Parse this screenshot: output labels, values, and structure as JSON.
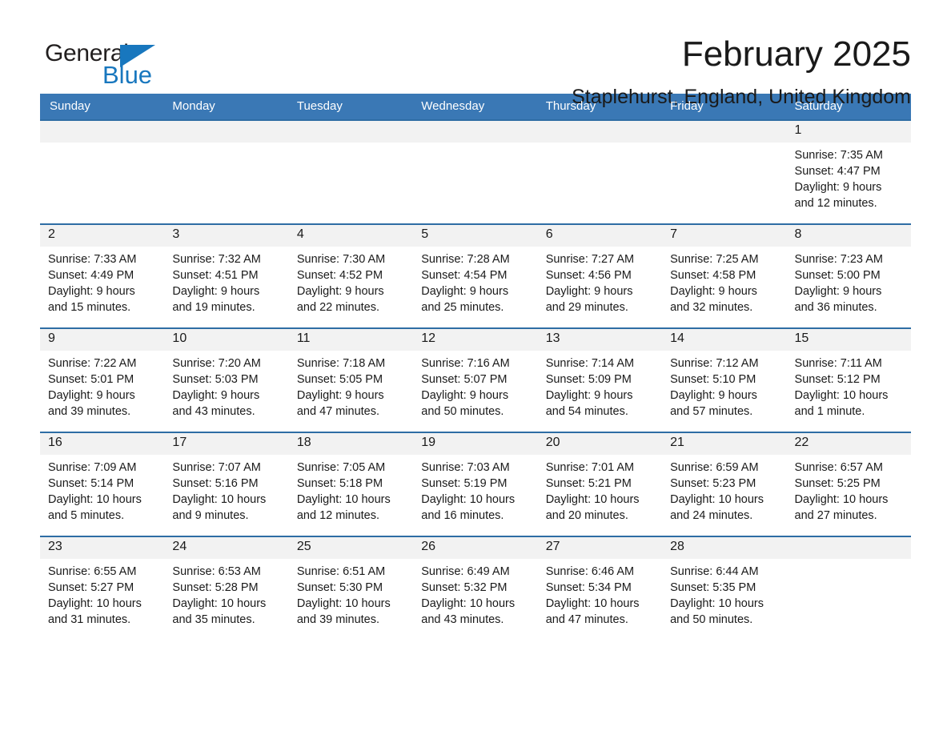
{
  "brand": {
    "name_part1": "General",
    "name_part2": "Blue",
    "flag_icon": "triangle-flag-icon",
    "accent_color": "#1877be"
  },
  "header": {
    "month_title": "February 2025",
    "location": "Staplehurst, England, United Kingdom"
  },
  "theme": {
    "header_row_bg": "#3a78b5",
    "cell_border": "#2e6da4",
    "daynum_bg": "#f2f2f2"
  },
  "weekday_headers": [
    "Sunday",
    "Monday",
    "Tuesday",
    "Wednesday",
    "Thursday",
    "Friday",
    "Saturday"
  ],
  "weeks": [
    [
      {
        "day": "",
        "empty": true
      },
      {
        "day": "",
        "empty": true
      },
      {
        "day": "",
        "empty": true
      },
      {
        "day": "",
        "empty": true
      },
      {
        "day": "",
        "empty": true
      },
      {
        "day": "",
        "empty": true
      },
      {
        "day": "1",
        "sunrise": "Sunrise: 7:35 AM",
        "sunset": "Sunset: 4:47 PM",
        "daylight_line1": "Daylight: 9 hours",
        "daylight_line2": "and 12 minutes."
      }
    ],
    [
      {
        "day": "2",
        "sunrise": "Sunrise: 7:33 AM",
        "sunset": "Sunset: 4:49 PM",
        "daylight_line1": "Daylight: 9 hours",
        "daylight_line2": "and 15 minutes."
      },
      {
        "day": "3",
        "sunrise": "Sunrise: 7:32 AM",
        "sunset": "Sunset: 4:51 PM",
        "daylight_line1": "Daylight: 9 hours",
        "daylight_line2": "and 19 minutes."
      },
      {
        "day": "4",
        "sunrise": "Sunrise: 7:30 AM",
        "sunset": "Sunset: 4:52 PM",
        "daylight_line1": "Daylight: 9 hours",
        "daylight_line2": "and 22 minutes."
      },
      {
        "day": "5",
        "sunrise": "Sunrise: 7:28 AM",
        "sunset": "Sunset: 4:54 PM",
        "daylight_line1": "Daylight: 9 hours",
        "daylight_line2": "and 25 minutes."
      },
      {
        "day": "6",
        "sunrise": "Sunrise: 7:27 AM",
        "sunset": "Sunset: 4:56 PM",
        "daylight_line1": "Daylight: 9 hours",
        "daylight_line2": "and 29 minutes."
      },
      {
        "day": "7",
        "sunrise": "Sunrise: 7:25 AM",
        "sunset": "Sunset: 4:58 PM",
        "daylight_line1": "Daylight: 9 hours",
        "daylight_line2": "and 32 minutes."
      },
      {
        "day": "8",
        "sunrise": "Sunrise: 7:23 AM",
        "sunset": "Sunset: 5:00 PM",
        "daylight_line1": "Daylight: 9 hours",
        "daylight_line2": "and 36 minutes."
      }
    ],
    [
      {
        "day": "9",
        "sunrise": "Sunrise: 7:22 AM",
        "sunset": "Sunset: 5:01 PM",
        "daylight_line1": "Daylight: 9 hours",
        "daylight_line2": "and 39 minutes."
      },
      {
        "day": "10",
        "sunrise": "Sunrise: 7:20 AM",
        "sunset": "Sunset: 5:03 PM",
        "daylight_line1": "Daylight: 9 hours",
        "daylight_line2": "and 43 minutes."
      },
      {
        "day": "11",
        "sunrise": "Sunrise: 7:18 AM",
        "sunset": "Sunset: 5:05 PM",
        "daylight_line1": "Daylight: 9 hours",
        "daylight_line2": "and 47 minutes."
      },
      {
        "day": "12",
        "sunrise": "Sunrise: 7:16 AM",
        "sunset": "Sunset: 5:07 PM",
        "daylight_line1": "Daylight: 9 hours",
        "daylight_line2": "and 50 minutes."
      },
      {
        "day": "13",
        "sunrise": "Sunrise: 7:14 AM",
        "sunset": "Sunset: 5:09 PM",
        "daylight_line1": "Daylight: 9 hours",
        "daylight_line2": "and 54 minutes."
      },
      {
        "day": "14",
        "sunrise": "Sunrise: 7:12 AM",
        "sunset": "Sunset: 5:10 PM",
        "daylight_line1": "Daylight: 9 hours",
        "daylight_line2": "and 57 minutes."
      },
      {
        "day": "15",
        "sunrise": "Sunrise: 7:11 AM",
        "sunset": "Sunset: 5:12 PM",
        "daylight_line1": "Daylight: 10 hours",
        "daylight_line2": "and 1 minute."
      }
    ],
    [
      {
        "day": "16",
        "sunrise": "Sunrise: 7:09 AM",
        "sunset": "Sunset: 5:14 PM",
        "daylight_line1": "Daylight: 10 hours",
        "daylight_line2": "and 5 minutes."
      },
      {
        "day": "17",
        "sunrise": "Sunrise: 7:07 AM",
        "sunset": "Sunset: 5:16 PM",
        "daylight_line1": "Daylight: 10 hours",
        "daylight_line2": "and 9 minutes."
      },
      {
        "day": "18",
        "sunrise": "Sunrise: 7:05 AM",
        "sunset": "Sunset: 5:18 PM",
        "daylight_line1": "Daylight: 10 hours",
        "daylight_line2": "and 12 minutes."
      },
      {
        "day": "19",
        "sunrise": "Sunrise: 7:03 AM",
        "sunset": "Sunset: 5:19 PM",
        "daylight_line1": "Daylight: 10 hours",
        "daylight_line2": "and 16 minutes."
      },
      {
        "day": "20",
        "sunrise": "Sunrise: 7:01 AM",
        "sunset": "Sunset: 5:21 PM",
        "daylight_line1": "Daylight: 10 hours",
        "daylight_line2": "and 20 minutes."
      },
      {
        "day": "21",
        "sunrise": "Sunrise: 6:59 AM",
        "sunset": "Sunset: 5:23 PM",
        "daylight_line1": "Daylight: 10 hours",
        "daylight_line2": "and 24 minutes."
      },
      {
        "day": "22",
        "sunrise": "Sunrise: 6:57 AM",
        "sunset": "Sunset: 5:25 PM",
        "daylight_line1": "Daylight: 10 hours",
        "daylight_line2": "and 27 minutes."
      }
    ],
    [
      {
        "day": "23",
        "sunrise": "Sunrise: 6:55 AM",
        "sunset": "Sunset: 5:27 PM",
        "daylight_line1": "Daylight: 10 hours",
        "daylight_line2": "and 31 minutes."
      },
      {
        "day": "24",
        "sunrise": "Sunrise: 6:53 AM",
        "sunset": "Sunset: 5:28 PM",
        "daylight_line1": "Daylight: 10 hours",
        "daylight_line2": "and 35 minutes."
      },
      {
        "day": "25",
        "sunrise": "Sunrise: 6:51 AM",
        "sunset": "Sunset: 5:30 PM",
        "daylight_line1": "Daylight: 10 hours",
        "daylight_line2": "and 39 minutes."
      },
      {
        "day": "26",
        "sunrise": "Sunrise: 6:49 AM",
        "sunset": "Sunset: 5:32 PM",
        "daylight_line1": "Daylight: 10 hours",
        "daylight_line2": "and 43 minutes."
      },
      {
        "day": "27",
        "sunrise": "Sunrise: 6:46 AM",
        "sunset": "Sunset: 5:34 PM",
        "daylight_line1": "Daylight: 10 hours",
        "daylight_line2": "and 47 minutes."
      },
      {
        "day": "28",
        "sunrise": "Sunrise: 6:44 AM",
        "sunset": "Sunset: 5:35 PM",
        "daylight_line1": "Daylight: 10 hours",
        "daylight_line2": "and 50 minutes."
      },
      {
        "day": "",
        "empty": true
      }
    ]
  ]
}
